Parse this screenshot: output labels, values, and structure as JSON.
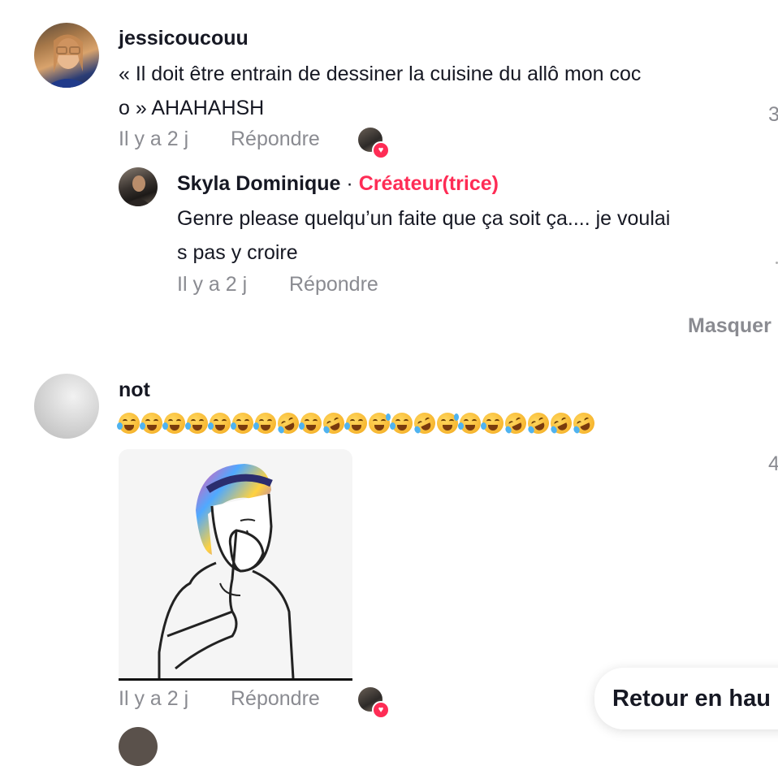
{
  "comments": [
    {
      "username": "jessicoucouu",
      "text_line1": "« Il doit être entrain de dessiner la cuisine du allô mon coc",
      "text_line2": "o » AHAHAHSH",
      "time": "Il y a 2 j",
      "reply_label": "Répondre",
      "like_count_partial": "3",
      "reply": {
        "username": "Skyla Dominique",
        "separator": "·",
        "badge": "Créateur(trice)",
        "text_line1": "Genre please quelqu’un faite que ça soit ça.... je voulai",
        "text_line2": "s pas y croire",
        "time": "Il y a 2 j",
        "reply_label": "Répondre"
      },
      "hide_label": "Masquer"
    },
    {
      "username": "not",
      "emojis": [
        "joy",
        "joy",
        "joy",
        "joy",
        "joy",
        "joy",
        "joy",
        "rofl",
        "joy",
        "rofl",
        "joy",
        "sweat",
        "joy",
        "rofl",
        "sweat",
        "joy",
        "joy",
        "rofl",
        "rofl",
        "rofl",
        "rofl"
      ],
      "time": "Il y a 2 j",
      "reply_label": "Répondre",
      "like_count_partial": "4"
    }
  ],
  "back_to_top_label": "Retour en hau",
  "colors": {
    "accent": "#fe2c55",
    "muted": "#8a8b91",
    "text": "#161823"
  }
}
